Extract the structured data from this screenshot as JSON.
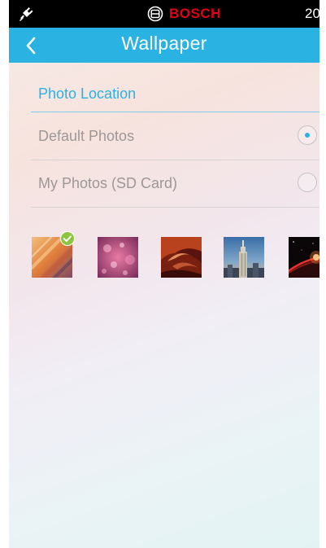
{
  "status_bar": {
    "brand": "BOSCH",
    "time": "20"
  },
  "header": {
    "title": "Wallpaper"
  },
  "photo_location": {
    "title": "Photo Location",
    "options": [
      {
        "label": "Default Photos",
        "selected": true
      },
      {
        "label": "My Photos (SD Card)",
        "selected": false
      }
    ]
  },
  "thumbnails": [
    {
      "name": "orange-stripes",
      "selected": true
    },
    {
      "name": "pink-bokeh",
      "selected": false
    },
    {
      "name": "red-canyon",
      "selected": false
    },
    {
      "name": "city-skyscraper",
      "selected": false
    },
    {
      "name": "planet-sunrise",
      "selected": false
    }
  ],
  "colors": {
    "accent": "#2ab2e3",
    "brand_red": "#e20015",
    "check_green": "#8cc63f"
  },
  "icons": [
    "plug-icon",
    "bosch-logo-icon",
    "back-chevron-icon",
    "radio-button",
    "check-icon"
  ]
}
